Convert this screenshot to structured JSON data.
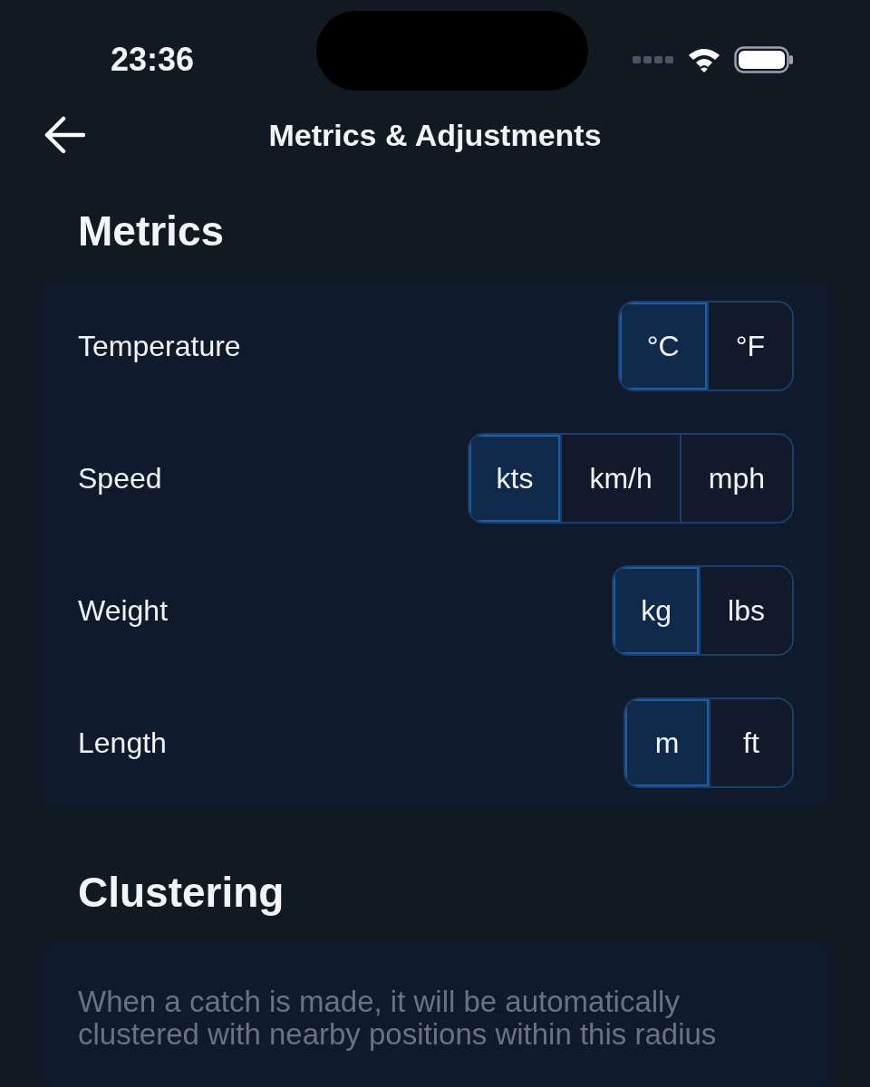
{
  "status_bar": {
    "time": "23:36"
  },
  "header": {
    "title": "Metrics & Adjustments"
  },
  "metrics": {
    "heading": "Metrics",
    "rows": [
      {
        "label": "Temperature",
        "options": [
          {
            "label": "°C",
            "selected": true
          },
          {
            "label": "°F",
            "selected": false
          }
        ]
      },
      {
        "label": "Speed",
        "options": [
          {
            "label": "kts",
            "selected": true
          },
          {
            "label": "km/h",
            "selected": false
          },
          {
            "label": "mph",
            "selected": false
          }
        ]
      },
      {
        "label": "Weight",
        "options": [
          {
            "label": "kg",
            "selected": true
          },
          {
            "label": "lbs",
            "selected": false
          }
        ]
      },
      {
        "label": "Length",
        "options": [
          {
            "label": "m",
            "selected": true
          },
          {
            "label": "ft",
            "selected": false
          }
        ]
      }
    ]
  },
  "clustering": {
    "heading": "Clustering",
    "description": "When a catch is made, it will be automatically clustered with nearby positions within this radius"
  }
}
